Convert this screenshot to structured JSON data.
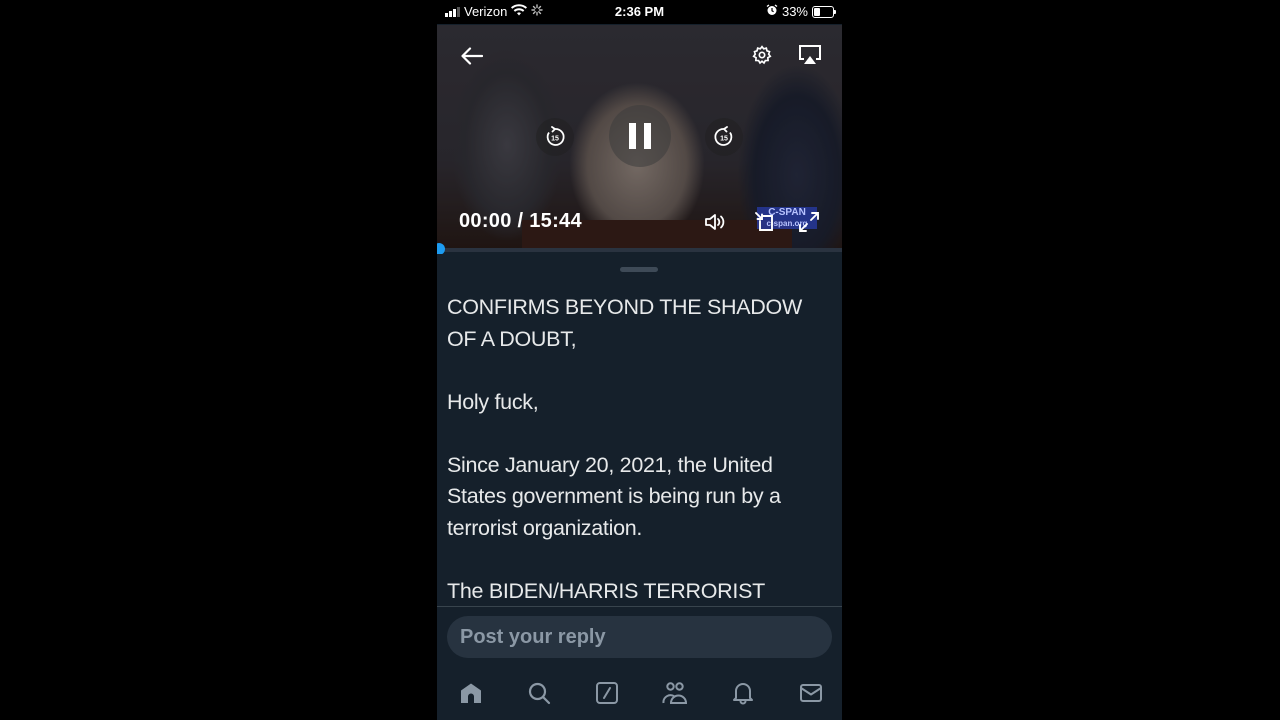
{
  "status_bar": {
    "carrier": "Verizon",
    "time": "2:36 PM",
    "battery_percent_label": "33%",
    "battery_level": 0.33,
    "icons": [
      "signal-icon",
      "wifi-icon",
      "activity-spinner-icon",
      "alarm-icon",
      "battery-icon"
    ]
  },
  "video_player": {
    "current_time": "00:00",
    "separator": " / ",
    "duration": "15:44",
    "progress_fraction": 0.0,
    "skip_back_seconds": "15",
    "skip_forward_seconds": "15",
    "watermark": {
      "line1": "C-SPAN",
      "line2": "c-span.org"
    },
    "state": "playing",
    "icons": {
      "back": "back-arrow-icon",
      "settings": "gear-icon",
      "airplay": "airplay-icon",
      "rewind": "rewind-15-icon",
      "pause": "pause-icon",
      "forward": "forward-15-icon",
      "volume": "volume-icon",
      "pip": "picture-in-picture-icon",
      "fullscreen": "fullscreen-icon"
    },
    "accent_color": "#1d9bf0"
  },
  "tweet": {
    "paragraphs": [
      "CONFIRMS BEYOND THE SHADOW OF A DOUBT,",
      "Holy fuck,",
      "Since January 20, 2021, the United States government is being run by a terrorist organization.",
      "The BIDEN/HARRIS TERRORIST"
    ]
  },
  "reply": {
    "placeholder": "Post your reply"
  },
  "tab_bar": {
    "items": [
      {
        "name": "home",
        "icon": "home-icon",
        "active": true
      },
      {
        "name": "search",
        "icon": "search-icon",
        "active": false
      },
      {
        "name": "grok",
        "icon": "grok-icon",
        "active": false
      },
      {
        "name": "communities",
        "icon": "communities-icon",
        "active": false
      },
      {
        "name": "notifications",
        "icon": "bell-icon",
        "active": false
      },
      {
        "name": "messages",
        "icon": "mail-icon",
        "active": false
      }
    ]
  },
  "colors": {
    "background": "#15202b",
    "text": "#e7e9ea",
    "muted": "#8b98a5",
    "reply_field": "#273340"
  }
}
